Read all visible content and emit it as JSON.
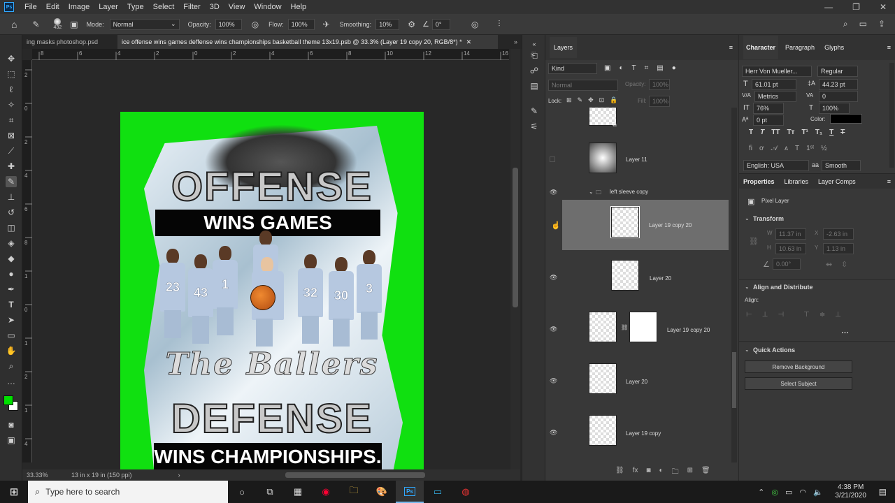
{
  "menubar": {
    "app_icon": "Ps",
    "items": [
      "File",
      "Edit",
      "Image",
      "Layer",
      "Type",
      "Select",
      "Filter",
      "3D",
      "View",
      "Window",
      "Help"
    ]
  },
  "options": {
    "brush_size": "432",
    "mode_label": "Mode:",
    "mode_value": "Normal",
    "opacity_label": "Opacity:",
    "opacity_value": "100%",
    "flow_label": "Flow:",
    "flow_value": "100%",
    "smoothing_label": "Smoothing:",
    "smoothing_value": "10%",
    "angle_value": "0°"
  },
  "tabs": [
    "ing masks photoshop.psd",
    "ice offense wins games deffense wins championships basketball theme 13x19.psb @ 33.3% (Layer 19 copy 20, RGB/8*) *"
  ],
  "ruler": {
    "h": [
      "8",
      "6",
      "4",
      "2",
      "0",
      "2",
      "4",
      "6",
      "8",
      "10",
      "12",
      "14",
      "16"
    ],
    "v": [
      "2",
      "0",
      "2",
      "4",
      "6",
      "8",
      "1",
      "0",
      "1",
      "2",
      "1",
      "4"
    ]
  },
  "poster": {
    "line1": "OFFENSE",
    "line2": "WINS GAMES",
    "script": "The Ballers",
    "line3": "DEFENSE",
    "line4": "WINS CHAMPIONSHIPS.",
    "jerseys": [
      "23",
      "43",
      "1",
      "",
      "",
      "32",
      "30",
      "3"
    ]
  },
  "status": {
    "zoom": "33.33%",
    "doc_size": "13 in x 19 in (150 ppi)"
  },
  "layers_panel": {
    "title": "Layers",
    "filter_kind": "Kind",
    "blend": "Normal",
    "opacity_label": "Opacity:",
    "opacity": "100%",
    "lock_label": "Lock:",
    "fill_label": "Fill:",
    "fill": "100%",
    "rows": [
      {
        "name": "",
        "visible": false
      },
      {
        "name": "Layer 11",
        "visible": false
      },
      {
        "name": "left sleeve copy",
        "group": true,
        "visible": true
      },
      {
        "name": "Layer 19 copy 20",
        "visible": false,
        "selected": true
      },
      {
        "name": "Layer 20",
        "visible": true
      },
      {
        "name": "Layer 19 copy 20",
        "visible": true,
        "mask": true
      },
      {
        "name": "Layer 20",
        "visible": true
      },
      {
        "name": "Layer 19 copy",
        "visible": true
      }
    ],
    "footer": [
      "link-icon",
      "fx",
      "mask-icon",
      "adjust-icon",
      "folder-icon",
      "new-icon",
      "trash-icon"
    ]
  },
  "character": {
    "tabs": [
      "Character",
      "Paragraph",
      "Glyphs"
    ],
    "font": "Herr Von Mueller...",
    "style": "Regular",
    "size": "61.01 pt",
    "leading": "44.23 pt",
    "kerning": "Metrics",
    "tracking": "0",
    "vscale": "76%",
    "hscale": "100%",
    "baseline": "0 pt",
    "color_label": "Color:",
    "language": "English: USA",
    "aa": "aa",
    "antialias": "Smooth"
  },
  "properties": {
    "tabs": [
      "Properties",
      "Libraries",
      "Layer Comps"
    ],
    "kind": "Pixel Layer",
    "transform": "Transform",
    "w_label": "W",
    "w": "11.37 in",
    "x_label": "X",
    "x": "-2.63 in",
    "h_label": "H",
    "h": "10.63 in",
    "y_label": "Y",
    "y": "1.13 in",
    "angle": "0.00°",
    "align_title": "Align and Distribute",
    "align_label": "Align:",
    "quick_actions": "Quick Actions",
    "remove_bg": "Remove Background",
    "select_subject": "Select Subject"
  },
  "taskbar": {
    "search_placeholder": "Type here to search",
    "time": "4:38 PM",
    "date": "3/21/2020"
  },
  "colors": {
    "fg": "#00e000",
    "bg": "#ffffff",
    "accent": "#31a8ff"
  }
}
